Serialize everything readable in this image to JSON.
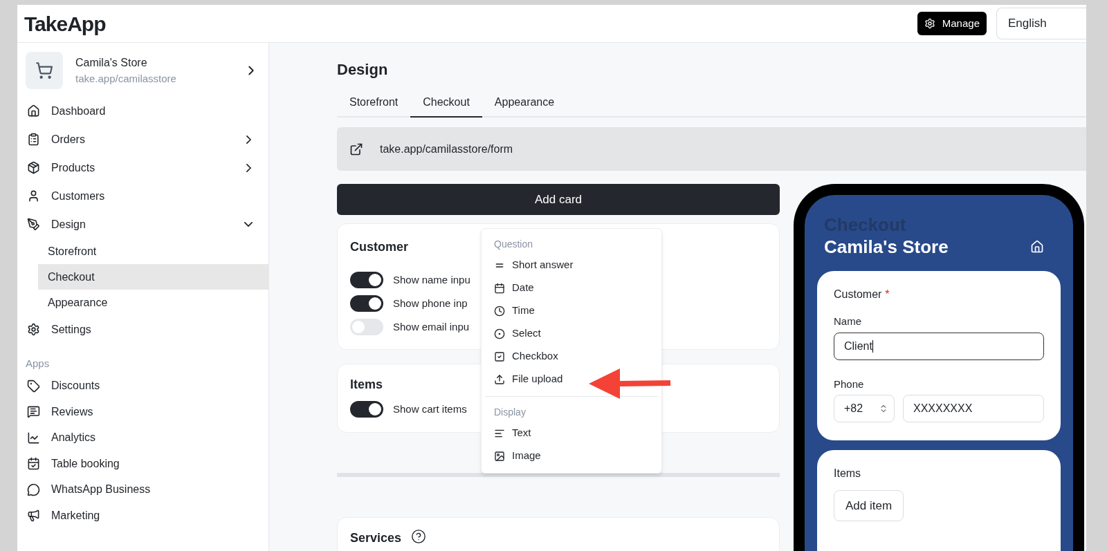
{
  "header": {
    "logo": "TakeApp",
    "manage": "Manage",
    "language": "English"
  },
  "store": {
    "name": "Camila's Store",
    "url": "take.app/camilasstore"
  },
  "nav": [
    {
      "label": "Dashboard",
      "kind": "link",
      "selected": false
    },
    {
      "label": "Orders",
      "kind": "group",
      "expanded": false,
      "selected": false
    },
    {
      "label": "Products",
      "kind": "group",
      "expanded": false,
      "selected": false
    },
    {
      "label": "Customers",
      "kind": "link",
      "selected": false
    },
    {
      "label": "Design",
      "kind": "group",
      "expanded": true,
      "selected": false,
      "children": [
        {
          "label": "Storefront",
          "selected": false
        },
        {
          "label": "Checkout",
          "selected": true
        },
        {
          "label": "Appearance",
          "selected": false
        }
      ]
    },
    {
      "label": "Settings",
      "kind": "link",
      "selected": false
    }
  ],
  "apps": {
    "heading": "Apps",
    "items": [
      {
        "label": "Discounts"
      },
      {
        "label": "Reviews"
      },
      {
        "label": "Analytics"
      },
      {
        "label": "Table booking"
      },
      {
        "label": "WhatsApp Business"
      },
      {
        "label": "Marketing"
      }
    ]
  },
  "page": {
    "title": "Design",
    "tabs": [
      {
        "label": "Storefront",
        "selected": false
      },
      {
        "label": "Checkout",
        "selected": true
      },
      {
        "label": "Appearance",
        "selected": false
      }
    ],
    "link": "take.app/camilasstore/form",
    "add_button": "Add card",
    "cards": [
      {
        "title": "Customer",
        "toggles": [
          {
            "label": "Show name inpu",
            "on": true
          },
          {
            "label": "Show phone inp",
            "on": true
          },
          {
            "label": "Show email inpu",
            "on": false
          }
        ]
      },
      {
        "title": "Items",
        "toggles": [
          {
            "label": "Show cart items",
            "on": true
          }
        ]
      }
    ],
    "services": {
      "title": "Services"
    }
  },
  "menu": {
    "sections": [
      {
        "heading": "Question",
        "items": [
          "Short answer",
          "Date",
          "Time",
          "Select",
          "Checkbox",
          "File upload"
        ]
      },
      {
        "heading": "Display",
        "items": [
          "Text",
          "Image"
        ]
      }
    ]
  },
  "phone": {
    "faded_title": "Checkout",
    "title": "Camila's Store",
    "customer": {
      "title": "Customer",
      "required_mark": "*",
      "name_label": "Name",
      "name_value": "Client",
      "phone_label": "Phone",
      "code": "+82",
      "phone_value": "XXXXXXXX"
    },
    "items": {
      "title": "Items",
      "button": "Add item"
    }
  }
}
